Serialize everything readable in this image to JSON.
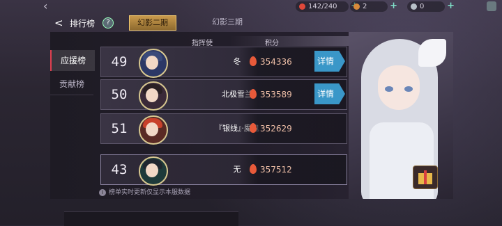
{
  "topbar": {
    "resources": [
      {
        "value": "142/240",
        "color": "#e0483a"
      },
      {
        "value": "2",
        "color": "#d98a3a"
      },
      {
        "value": "0",
        "color": "#b8c0c8"
      }
    ]
  },
  "header": {
    "back_label": "<",
    "title": "排行榜",
    "help_label": "?",
    "tabs": [
      {
        "label": "幻影二期",
        "active": true
      },
      {
        "label": "幻影三期",
        "active": false
      }
    ]
  },
  "side_tabs": [
    {
      "label": "应援榜",
      "active": true
    },
    {
      "label": "贡献榜",
      "active": false
    }
  ],
  "columns": {
    "commander": "指挥使",
    "score": "积分"
  },
  "rows": [
    {
      "rank": "49",
      "name": "冬",
      "score": "354336",
      "detail": "详情",
      "hair_color": "#3a4a7a"
    },
    {
      "rank": "50",
      "name": "北极雪兰",
      "score": "353589",
      "detail": "详情",
      "hair_color": "#2a2024"
    },
    {
      "rank": "51",
      "name": "『银线』·魔鬼",
      "score": "352629",
      "detail": "",
      "hair_color": "#c8402a"
    }
  ],
  "self_row": {
    "rank": "43",
    "name": "无",
    "score": "357512",
    "hair_color": "#20262e"
  },
  "note": "榜单实时更新仅显示本服数据",
  "icons": {
    "flame": "flame-icon",
    "gift": "gift-icon",
    "info": "info-icon"
  }
}
